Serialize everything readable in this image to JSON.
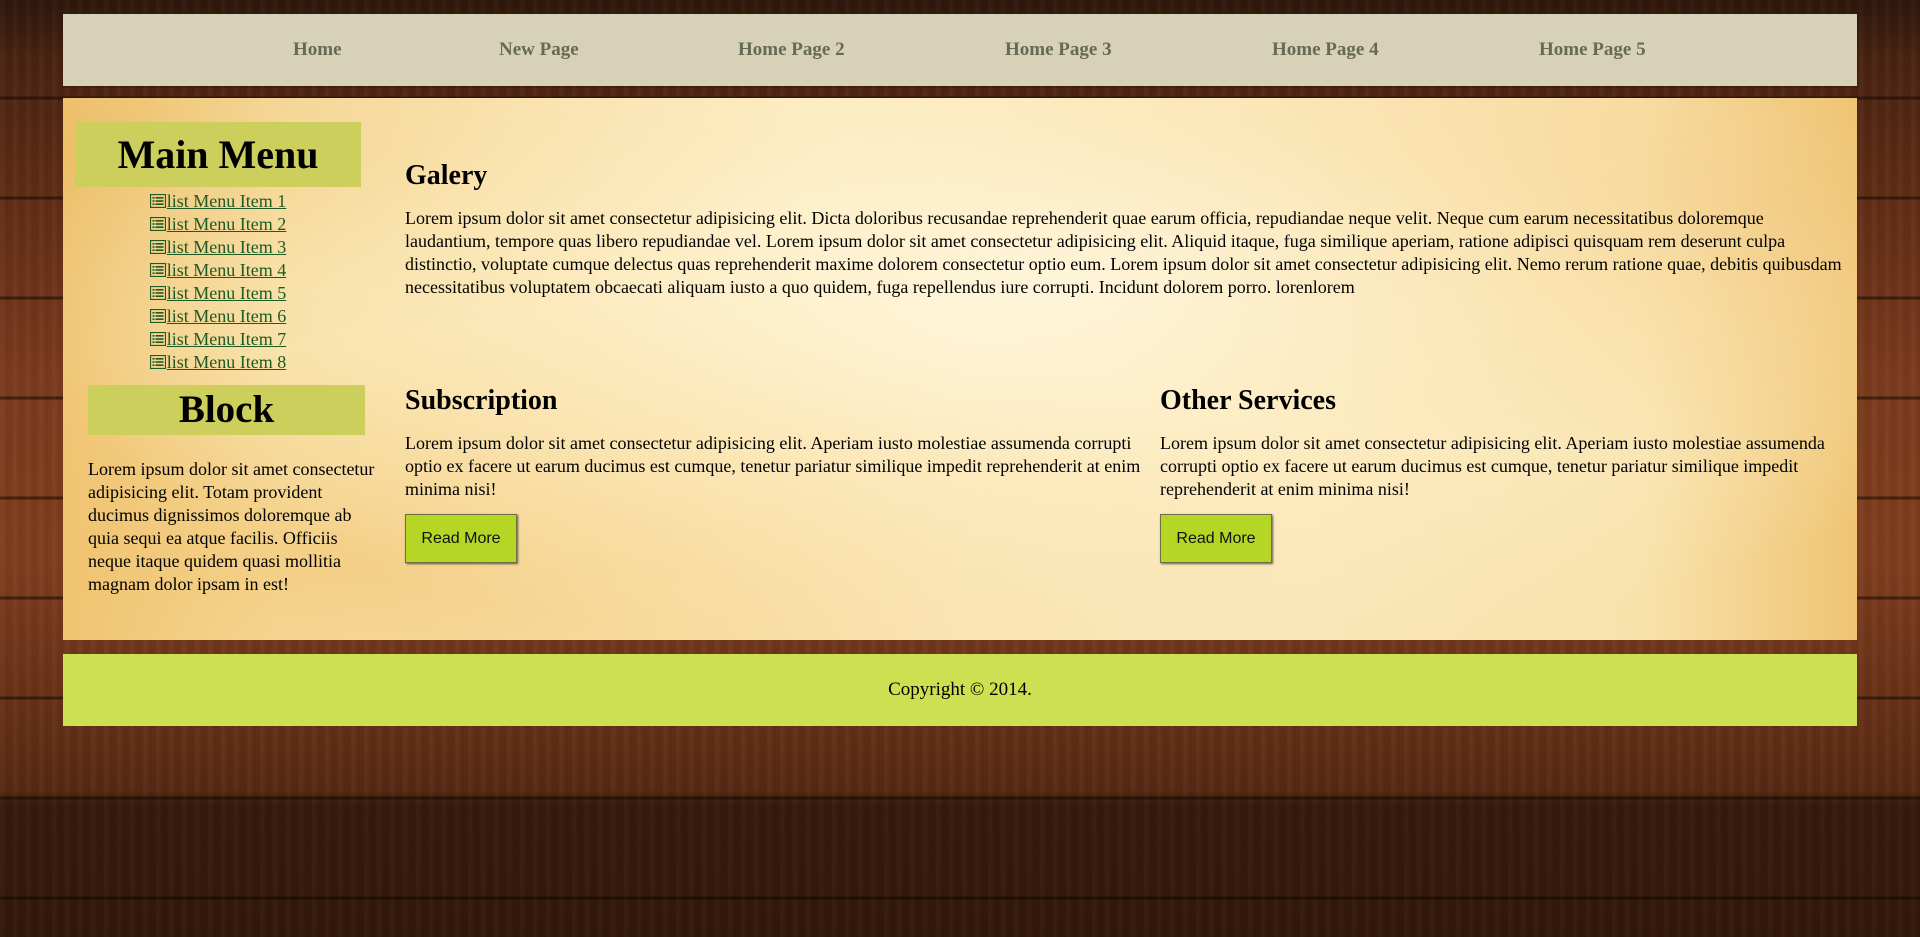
{
  "nav": {
    "items": [
      {
        "label": "Home"
      },
      {
        "label": "New Page"
      },
      {
        "label": "Home Page 2"
      },
      {
        "label": "Home Page 3"
      },
      {
        "label": "Home Page 4"
      },
      {
        "label": "Home Page 5"
      }
    ]
  },
  "sidebar": {
    "menu_title": "Main Menu",
    "menu_items": [
      {
        "label": "list Menu Item 1",
        "icon": "list-icon"
      },
      {
        "label": "list Menu Item 2",
        "icon": "list-icon"
      },
      {
        "label": "list Menu Item 3",
        "icon": "list-icon"
      },
      {
        "label": "list Menu Item 4",
        "icon": "list-icon"
      },
      {
        "label": "list Menu Item 5",
        "icon": "list-icon"
      },
      {
        "label": "list Menu Item 6",
        "icon": "list-icon"
      },
      {
        "label": "list Menu Item 7",
        "icon": "list-icon"
      },
      {
        "label": "list Menu Item 8",
        "icon": "list-icon"
      }
    ],
    "block_title": "Block",
    "block_text": "Lorem ipsum dolor sit amet consectetur adipisicing elit. Totam provident ducimus dignissimos doloremque ab quia sequi ea atque facilis. Officiis neque itaque quidem quasi mollitia magnam dolor ipsam in est!"
  },
  "main": {
    "galery": {
      "title": "Galery",
      "text": "Lorem ipsum dolor sit amet consectetur adipisicing elit. Dicta doloribus recusandae reprehenderit quae earum officia, repudiandae neque velit. Neque cum earum necessitatibus doloremque laudantium, tempore quas libero repudiandae vel. Lorem ipsum dolor sit amet consectetur adipisicing elit. Aliquid itaque, fuga similique aperiam, ratione adipisci quisquam rem deserunt culpa distinctio, voluptate cumque delectus quas reprehenderit maxime dolorem consectetur optio eum. Lorem ipsum dolor sit amet consectetur adipisicing elit. Nemo rerum ratione quae, debitis quibusdam necessitatibus voluptatem obcaecati aliquam iusto a quo quidem, fuga repellendus iure corrupti. Incidunt dolorem porro. lorenlorem"
    },
    "subscription": {
      "title": "Subscription",
      "text": "Lorem ipsum dolor sit amet consectetur adipisicing elit. Aperiam iusto molestiae assumenda corrupti optio ex facere ut earum ducimus est cumque, tenetur pariatur similique impedit reprehenderit at enim minima nisi!",
      "button_label": "Read More"
    },
    "other_services": {
      "title": "Other Services",
      "text": "Lorem ipsum dolor sit amet consectetur adipisicing elit. Aperiam iusto molestiae assumenda corrupti optio ex facere ut earum ducimus est cumque, tenetur pariatur similique impedit reprehenderit at enim minima nisi!",
      "button_label": "Read More"
    }
  },
  "footer": {
    "copyright": "Copyright © 2014."
  },
  "colors": {
    "nav_background": "#d7d1b7",
    "nav_link": "#666a55",
    "title_box": "#cdcf5c",
    "menu_link": "#1e5a22",
    "button": "#b6d625",
    "footer_background": "#cde051"
  }
}
